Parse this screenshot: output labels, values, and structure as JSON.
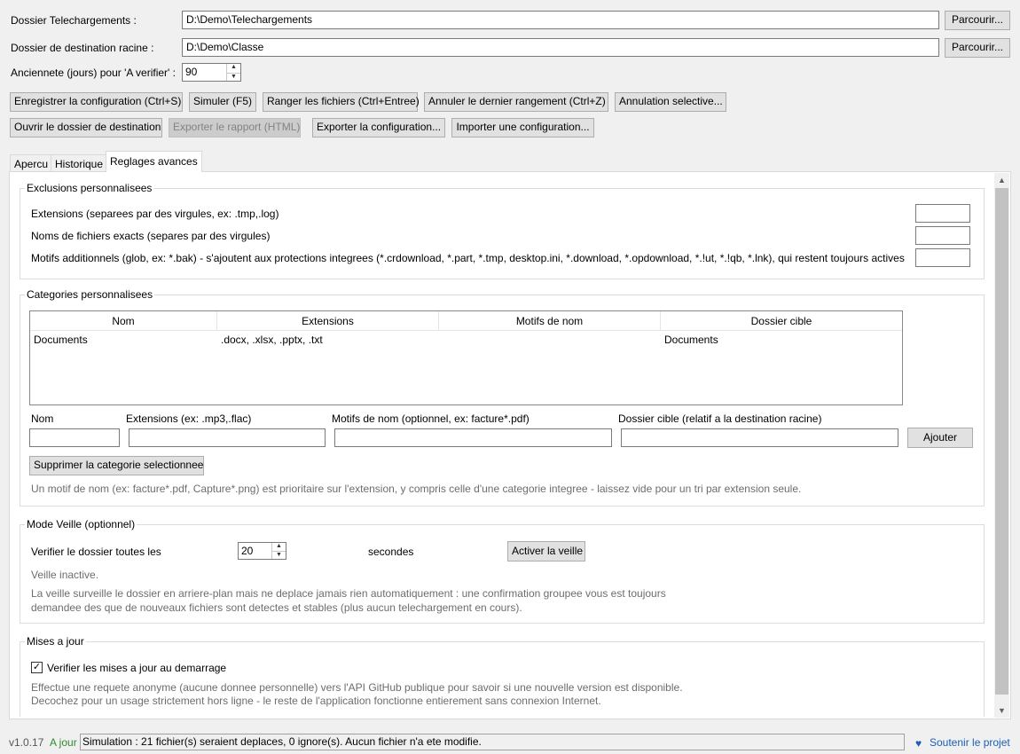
{
  "config": {
    "download_label": "Dossier Telechargements :",
    "download_value": "D:\\Demo\\Telechargements",
    "dest_label": "Dossier de destination racine :",
    "dest_value": "D:\\Demo\\Classe",
    "browse_label": "Parcourir...",
    "age_label": "Anciennete (jours) pour 'A verifier' :",
    "age_value": "90"
  },
  "toolbar": {
    "save": "Enregistrer la configuration (Ctrl+S)",
    "simulate": "Simuler (F5)",
    "sort": "Ranger les fichiers (Ctrl+Entree)",
    "undo": "Annuler le dernier rangement (Ctrl+Z)",
    "selective_undo": "Annulation selective...",
    "open_dest": "Ouvrir le dossier de destination",
    "export_report": "Exporter le rapport (HTML)",
    "export_config": "Exporter la configuration...",
    "import_config": "Importer une configuration..."
  },
  "tabs": [
    "Apercu",
    "Historique",
    "Reglages avances"
  ],
  "exclusions": {
    "title": "Exclusions personnalisees",
    "extensions_label": "Extensions (separees par des virgules, ex: .tmp,.log)",
    "names_label": "Noms de fichiers exacts (separes par des virgules)",
    "patterns_label": "Motifs additionnels (glob, ex: *.bak) - s'ajoutent aux protections integrees (*.crdownload, *.part, *.tmp, desktop.ini, *.download, *.opdownload, *.!ut, *.!qb, *.lnk), qui restent toujours actives",
    "extensions_value": "",
    "names_value": "",
    "patterns_value": ""
  },
  "categories": {
    "title": "Categories personnalisees",
    "columns": [
      "Nom",
      "Extensions",
      "Motifs de nom",
      "Dossier cible"
    ],
    "rows": [
      [
        "Documents",
        ".docx, .xlsx, .pptx, .txt",
        "",
        "Documents"
      ]
    ],
    "name_label": "Nom",
    "ext_label": "Extensions (ex: .mp3,.flac)",
    "pattern_label": "Motifs de nom (optionnel, ex: facture*.pdf)",
    "target_label": "Dossier cible (relatif a la destination racine)",
    "add_label": "Ajouter",
    "delete_label": "Supprimer la categorie selectionnee",
    "hint": "Un motif de nom (ex: facture*.pdf, Capture*.png) est prioritaire sur l'extension, y compris celle d'une categorie integree - laissez vide pour un tri par extension seule."
  },
  "watch": {
    "title": "Mode Veille (optionnel)",
    "interval_label": "Verifier le dossier toutes les",
    "interval_value": "20",
    "seconds_label": "secondes",
    "activate_label": "Activer la veille",
    "status": "Veille inactive.",
    "desc_line1": "La veille surveille le dossier en arriere-plan mais ne deplace jamais rien automatiquement : une confirmation groupee vous est toujours",
    "desc_line2": "demandee des que de nouveaux fichiers sont detectes et stables (plus aucun telechargement en cours)."
  },
  "updates": {
    "title": "Mises a jour",
    "check_label": "Verifier les mises a jour au demarrage",
    "checked": true,
    "desc_line1": "Effectue une requete anonyme (aucune donnee personnelle) vers l'API GitHub publique pour savoir si une nouvelle version est disponible.",
    "desc_line2": "Decochez pour un usage strictement hors ligne - le reste de l'application fonctionne entierement sans connexion Internet."
  },
  "status": {
    "version": "v1.0.17",
    "uptodate": "A jour",
    "message": "Simulation : 21 fichier(s) seraient deplaces, 0 ignore(s). Aucun fichier n'a ete modifie.",
    "support": "Soutenir le projet",
    "uptodate_color": "#2e8b2e",
    "link_color": "#1a5fb4"
  }
}
